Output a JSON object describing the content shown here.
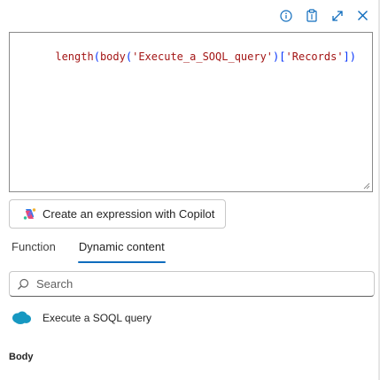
{
  "toolbar": {
    "info_icon": "info-icon",
    "paste_icon": "clipboard-icon",
    "expand_icon": "expand-icon",
    "close_icon": "close-icon"
  },
  "editor": {
    "tokens": [
      {
        "text": "length",
        "kind": "fn"
      },
      {
        "text": "(",
        "kind": "paren"
      },
      {
        "text": "body",
        "kind": "fn"
      },
      {
        "text": "(",
        "kind": "paren"
      },
      {
        "text": "'Execute_a_SOQL_query'",
        "kind": "str"
      },
      {
        "text": ")",
        "kind": "paren"
      },
      {
        "text": "[",
        "kind": "brk"
      },
      {
        "text": "'Records'",
        "kind": "str"
      },
      {
        "text": "]",
        "kind": "brk"
      },
      {
        "text": ")",
        "kind": "paren"
      }
    ]
  },
  "copilot": {
    "label": "Create an expression with Copilot",
    "icon": "copilot-icon"
  },
  "tabs": [
    {
      "label": "Function",
      "active": false
    },
    {
      "label": "Dynamic content",
      "active": true
    }
  ],
  "search": {
    "placeholder": "Search",
    "value": ""
  },
  "dynamic_content": {
    "group_label": "Execute a SOQL query",
    "group_icon": "salesforce-cloud-icon",
    "items": [
      {
        "label": "Body"
      }
    ]
  },
  "colors": {
    "accent": "#0f6cbd",
    "token_fn": "#a31515",
    "token_paren": "#0431fa",
    "salesforce": "#1798c1"
  }
}
